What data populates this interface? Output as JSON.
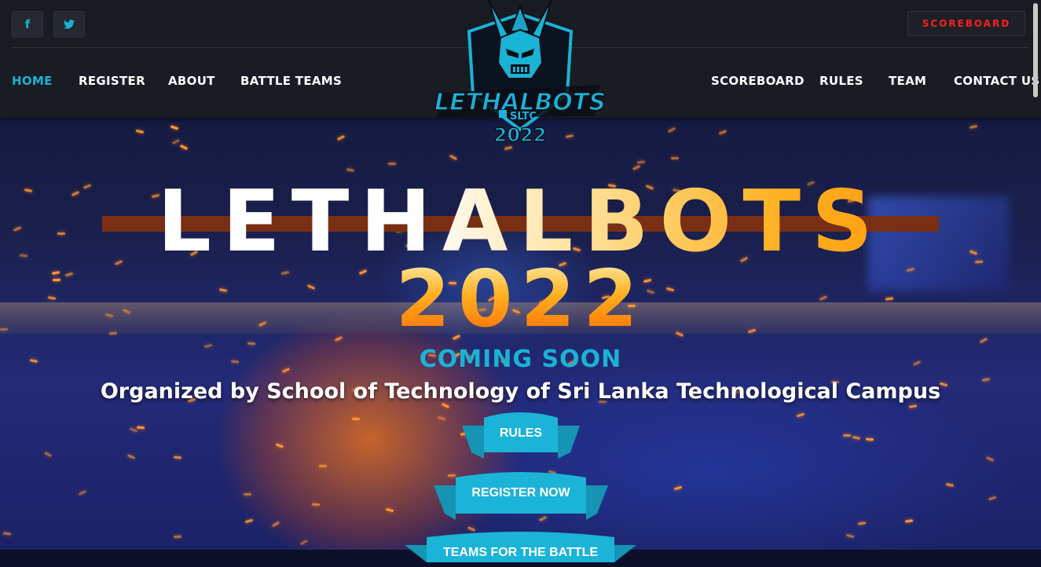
{
  "header": {
    "social": [
      {
        "icon": "facebook-icon",
        "glyph": "f"
      },
      {
        "icon": "twitter-icon",
        "glyph": "🐦"
      }
    ],
    "scoreboard_button": "SCOREBOARD",
    "nav_left": [
      "HOME",
      "REGISTER",
      "ABOUT",
      "BATTLE TEAMS"
    ],
    "nav_right": [
      "SCOREBOARD",
      "RULES",
      "TEAM",
      "CONTACT US"
    ],
    "active_nav": "HOME",
    "logo": {
      "name": "LETHALBOTS",
      "org": "SLTC",
      "year": "2022"
    }
  },
  "hero": {
    "title": "LETHALBOTS",
    "year": "2022",
    "status": "COMING SOON",
    "organizer": "Organized by School of Technology of Sri Lanka Technological Campus",
    "buttons": [
      "RULES",
      "REGISTER NOW",
      "TEAMS FOR THE BATTLE"
    ]
  },
  "colors": {
    "accent": "#19b3d6",
    "header_bg": "#1a1c22",
    "scoreboard_text": "#ff1f1f",
    "strike": "#7a2e14"
  }
}
